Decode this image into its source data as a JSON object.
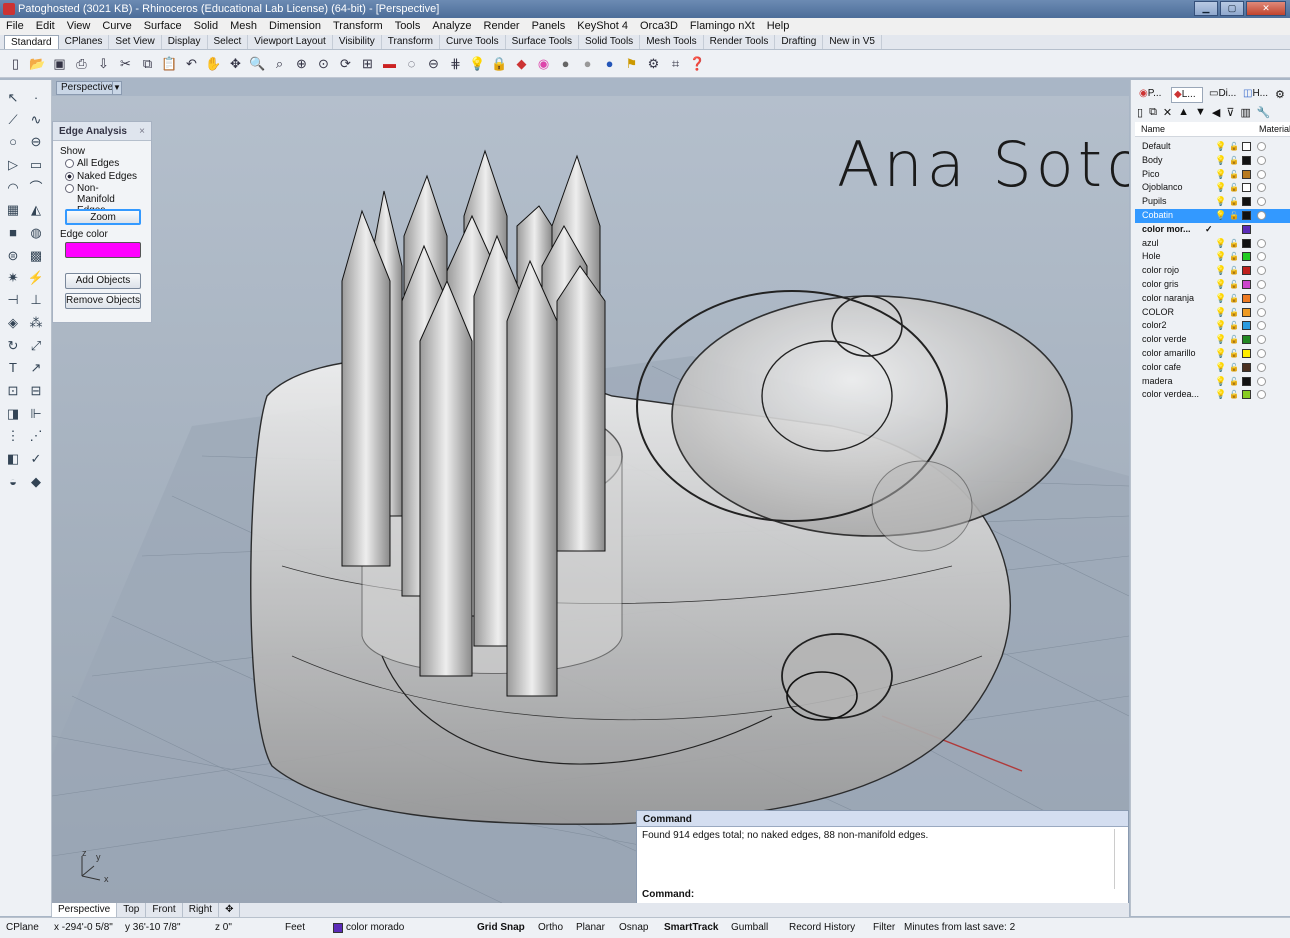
{
  "window": {
    "title": "Patoghosted (3021 KB) - Rhinoceros (Educational Lab License) (64-bit) - [Perspective]"
  },
  "menu": [
    "File",
    "Edit",
    "View",
    "Curve",
    "Surface",
    "Solid",
    "Mesh",
    "Dimension",
    "Transform",
    "Tools",
    "Analyze",
    "Render",
    "Panels",
    "KeyShot 4",
    "Orca3D",
    "Flamingo nXt",
    "Help"
  ],
  "tabs": [
    "Standard",
    "CPlanes",
    "Set View",
    "Display",
    "Select",
    "Viewport Layout",
    "Visibility",
    "Transform",
    "Curve Tools",
    "Surface Tools",
    "Solid Tools",
    "Mesh Tools",
    "Render Tools",
    "Drafting",
    "New in V5"
  ],
  "toolbar_icons": [
    "new-icon",
    "open-icon",
    "save-icon",
    "print-icon",
    "import-icon",
    "cut-icon",
    "copy-icon",
    "paste-icon",
    "undo-icon",
    "pan-icon",
    "move-icon",
    "zoom-icon",
    "zoom-window-icon",
    "zoom-extents-icon",
    "zoom-selected-icon",
    "rotate-icon",
    "four-viewports-icon",
    "car-icon",
    "lasso-icon",
    "cplane-icon",
    "grid-icon",
    "light-icon",
    "lock-icon",
    "layer-icon",
    "color-wheel-icon",
    "shaded-sphere-icon",
    "rendered-sphere-icon",
    "blue-sphere-icon",
    "render-icon",
    "gear-icon",
    "snap-icon",
    "help-icon"
  ],
  "viewport": {
    "label": "Perspective",
    "signature": "Ana Soto",
    "axis_z": "z",
    "axis_y": "y",
    "axis_x": "x"
  },
  "edge_panel": {
    "title": "Edge Analysis",
    "show_label": "Show",
    "options": [
      "All Edges",
      "Naked Edges",
      "Non-Manifold Edges"
    ],
    "selected": "Naked Edges",
    "zoom_button": "Zoom",
    "edge_color_label": "Edge color",
    "edge_color": "#ff00ff",
    "add_button": "Add Objects",
    "remove_button": "Remove Objects"
  },
  "right_panel": {
    "tabs": [
      "P...",
      "L...",
      "Di...",
      "H..."
    ],
    "col_name": "Name",
    "col_material": "Material",
    "layers": [
      {
        "name": "Default",
        "color": "#ffffff"
      },
      {
        "name": "Body",
        "color": "#111111"
      },
      {
        "name": "Pico",
        "color": "#b87a1f"
      },
      {
        "name": "Ojoblanco",
        "color": "#ffffff"
      },
      {
        "name": "Pupils",
        "color": "#111111"
      },
      {
        "name": "Cobatin",
        "color": "#111111",
        "selected": true
      },
      {
        "name": "color mor...",
        "color": "#5b2bb8",
        "current": true
      },
      {
        "name": "azul",
        "color": "#111111"
      },
      {
        "name": "Hole",
        "color": "#22cc22"
      },
      {
        "name": "color rojo",
        "color": "#c0201c"
      },
      {
        "name": "color gris",
        "color": "#cc44cc"
      },
      {
        "name": "color naranja",
        "color": "#ee7a22"
      },
      {
        "name": "COLOR",
        "color": "#ee9a22"
      },
      {
        "name": "color2",
        "color": "#2a9be0"
      },
      {
        "name": "color verde",
        "color": "#228822"
      },
      {
        "name": "color amarillo",
        "color": "#ffee00"
      },
      {
        "name": "color cafe",
        "color": "#4a3020"
      },
      {
        "name": "madera",
        "color": "#111111"
      },
      {
        "name": "color verdea...",
        "color": "#88cc22"
      }
    ]
  },
  "command": {
    "title": "Command",
    "message": "Found 914 edges total; no naked edges, 88 non-manifold edges.",
    "prompt": "Command:"
  },
  "viewport_tabs": [
    "Perspective",
    "Top",
    "Front",
    "Right"
  ],
  "status": {
    "cplane": "CPlane",
    "x": "x -294'-0 5/8\"",
    "y": "y 36'-10 7/8\"",
    "z": "z 0\"",
    "units": "Feet",
    "layer": "color morado",
    "layer_color": "#5b2bb8",
    "toggles": [
      "Grid Snap",
      "Ortho",
      "Planar",
      "Osnap",
      "SmartTrack",
      "Gumball",
      "Record History",
      "Filter"
    ],
    "save": "Minutes from last save: 2"
  }
}
